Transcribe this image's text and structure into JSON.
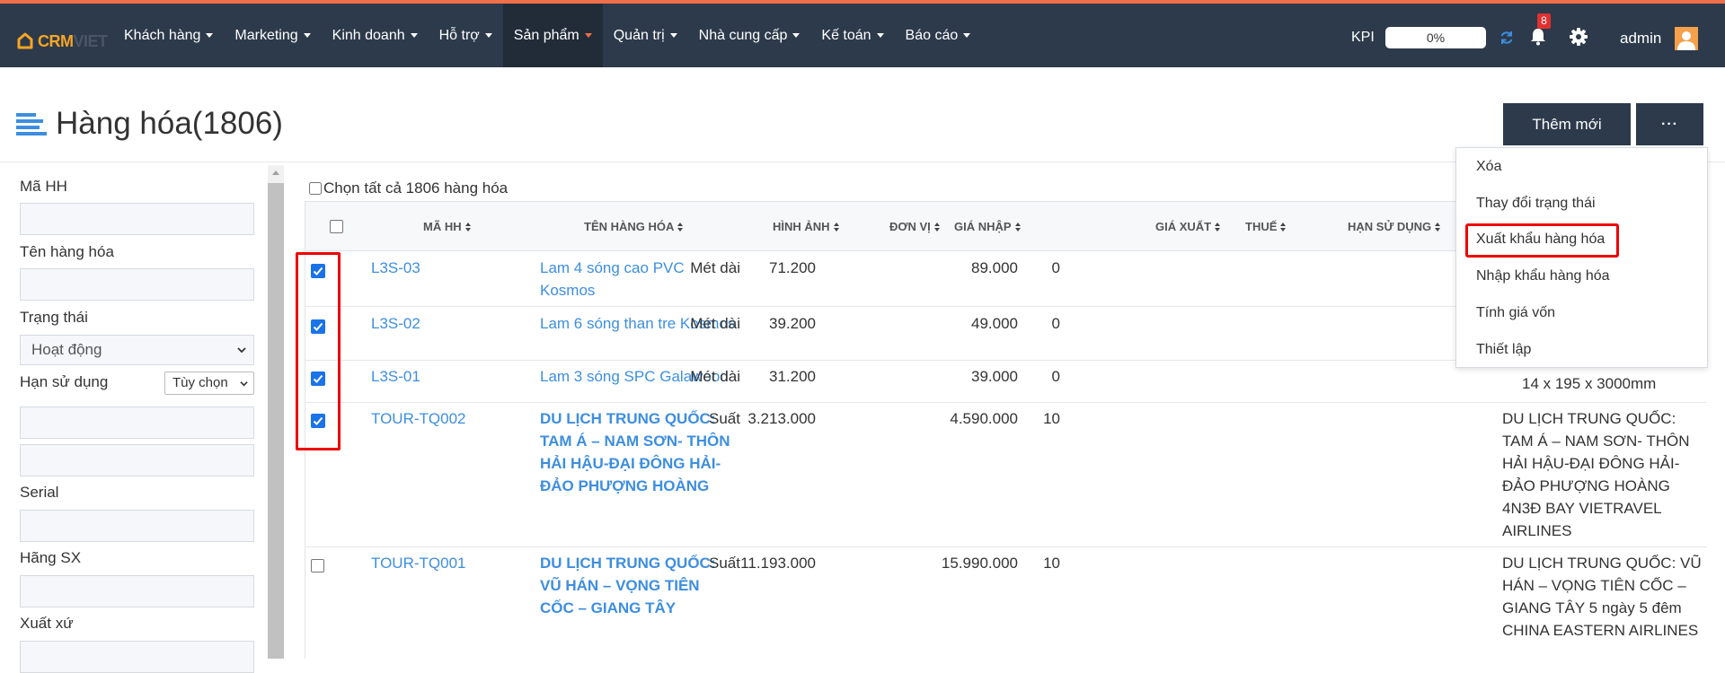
{
  "app": {
    "logo_text_1": "CRM",
    "logo_text_2": "VIET"
  },
  "nav": {
    "items": [
      {
        "label": "Khách hàng"
      },
      {
        "label": "Marketing"
      },
      {
        "label": "Kinh doanh"
      },
      {
        "label": "Hỗ trợ"
      },
      {
        "label": "Sản phẩm",
        "active": true
      },
      {
        "label": "Quản trị"
      },
      {
        "label": "Nhà cung cấp"
      },
      {
        "label": "Kế toán"
      },
      {
        "label": "Báo cáo"
      }
    ],
    "kpi_label": "KPI",
    "kpi_value": "0%",
    "notification_count": "8",
    "user_name": "admin"
  },
  "page": {
    "title": "Hàng hóa(1806)",
    "add_button": "Thêm mới",
    "more_button": "···",
    "select_all_label": "Chọn tất cả 1806 hàng hóa"
  },
  "filters": {
    "code_label": "Mã HH",
    "name_label": "Tên hàng hóa",
    "status_label": "Trạng thái",
    "status_value": "Hoạt động",
    "expiry_label": "Hạn sử dụng",
    "expiry_option": "Tùy chọn",
    "serial_label": "Serial",
    "manufacturer_label": "Hãng SX",
    "origin_label": "Xuất xứ"
  },
  "table": {
    "headers": {
      "code": "MÃ HH",
      "name": "TÊN HÀNG HÓA",
      "image": "HÌNH ẢNH",
      "unit": "ĐƠN VỊ",
      "price_in": "GIÁ NHẬP",
      "price_out": "GIÁ XUẤT",
      "tax": "THUẾ",
      "expiry": "HẠN SỬ DỤNG"
    },
    "rows": [
      {
        "checked": true,
        "code": "L3S-03",
        "name": "Lam 4 sóng cao PVC Kosmos",
        "unit": "Mét dài",
        "price_in": "71.200",
        "price_out": "89.000",
        "tax": "0",
        "desc": ""
      },
      {
        "checked": true,
        "code": "L3S-02",
        "name": "Lam 6 sóng than tre Kosmos",
        "unit": "Mét dài",
        "price_in": "39.200",
        "price_out": "49.000",
        "tax": "0",
        "desc": ""
      },
      {
        "checked": true,
        "code": "L3S-01",
        "name": "Lam 3 sóng SPC Galawood",
        "unit": "Mét dài",
        "price_in": "31.200",
        "price_out": "39.000",
        "tax": "0",
        "desc": "14 x 195 x 3000mm"
      },
      {
        "checked": true,
        "code": "TOUR-TQ002",
        "name": "DU LỊCH TRUNG QUỐC: TAM Á – NAM SƠN- THÔN HẢI HẬU-ĐẠI ĐÔNG HẢI-ĐẢO PHƯỢNG HOÀNG",
        "unit": "Suất",
        "price_in": "3.213.000",
        "price_out": "4.590.000",
        "tax": "10",
        "desc": "DU LỊCH TRUNG QUỐC: TAM Á – NAM SƠN- THÔN HẢI HẬU-ĐẠI ĐÔNG HẢI-ĐẢO PHƯỢNG HOÀNG 4N3Đ BAY VIETRAVEL AIRLINES"
      },
      {
        "checked": false,
        "code": "TOUR-TQ001",
        "name": "DU LỊCH TRUNG QUỐC: VŨ HÁN – VỌNG TIÊN CỐC – GIANG TÂY",
        "unit": "Suất",
        "price_in": "11.193.000",
        "price_out": "15.990.000",
        "tax": "10",
        "desc": "DU LỊCH TRUNG QUỐC: VŨ HÁN – VỌNG TIÊN CỐC – GIANG TÂY 5 ngày 5 đêm CHINA EASTERN AIRLINES"
      }
    ]
  },
  "dropdown": {
    "items": [
      {
        "label": "Xóa"
      },
      {
        "label": "Thay đổi trạng thái"
      },
      {
        "label": "Xuất khẩu hàng hóa",
        "highlighted": true
      },
      {
        "label": "Nhập khẩu hàng hóa"
      },
      {
        "label": "Tính giá vốn"
      },
      {
        "label": "Thiết lập"
      }
    ]
  },
  "colors": {
    "topbar": "#2d3a4b",
    "accent": "#f36f4a",
    "link": "#3d8ee0",
    "highlight": "#e00000"
  }
}
